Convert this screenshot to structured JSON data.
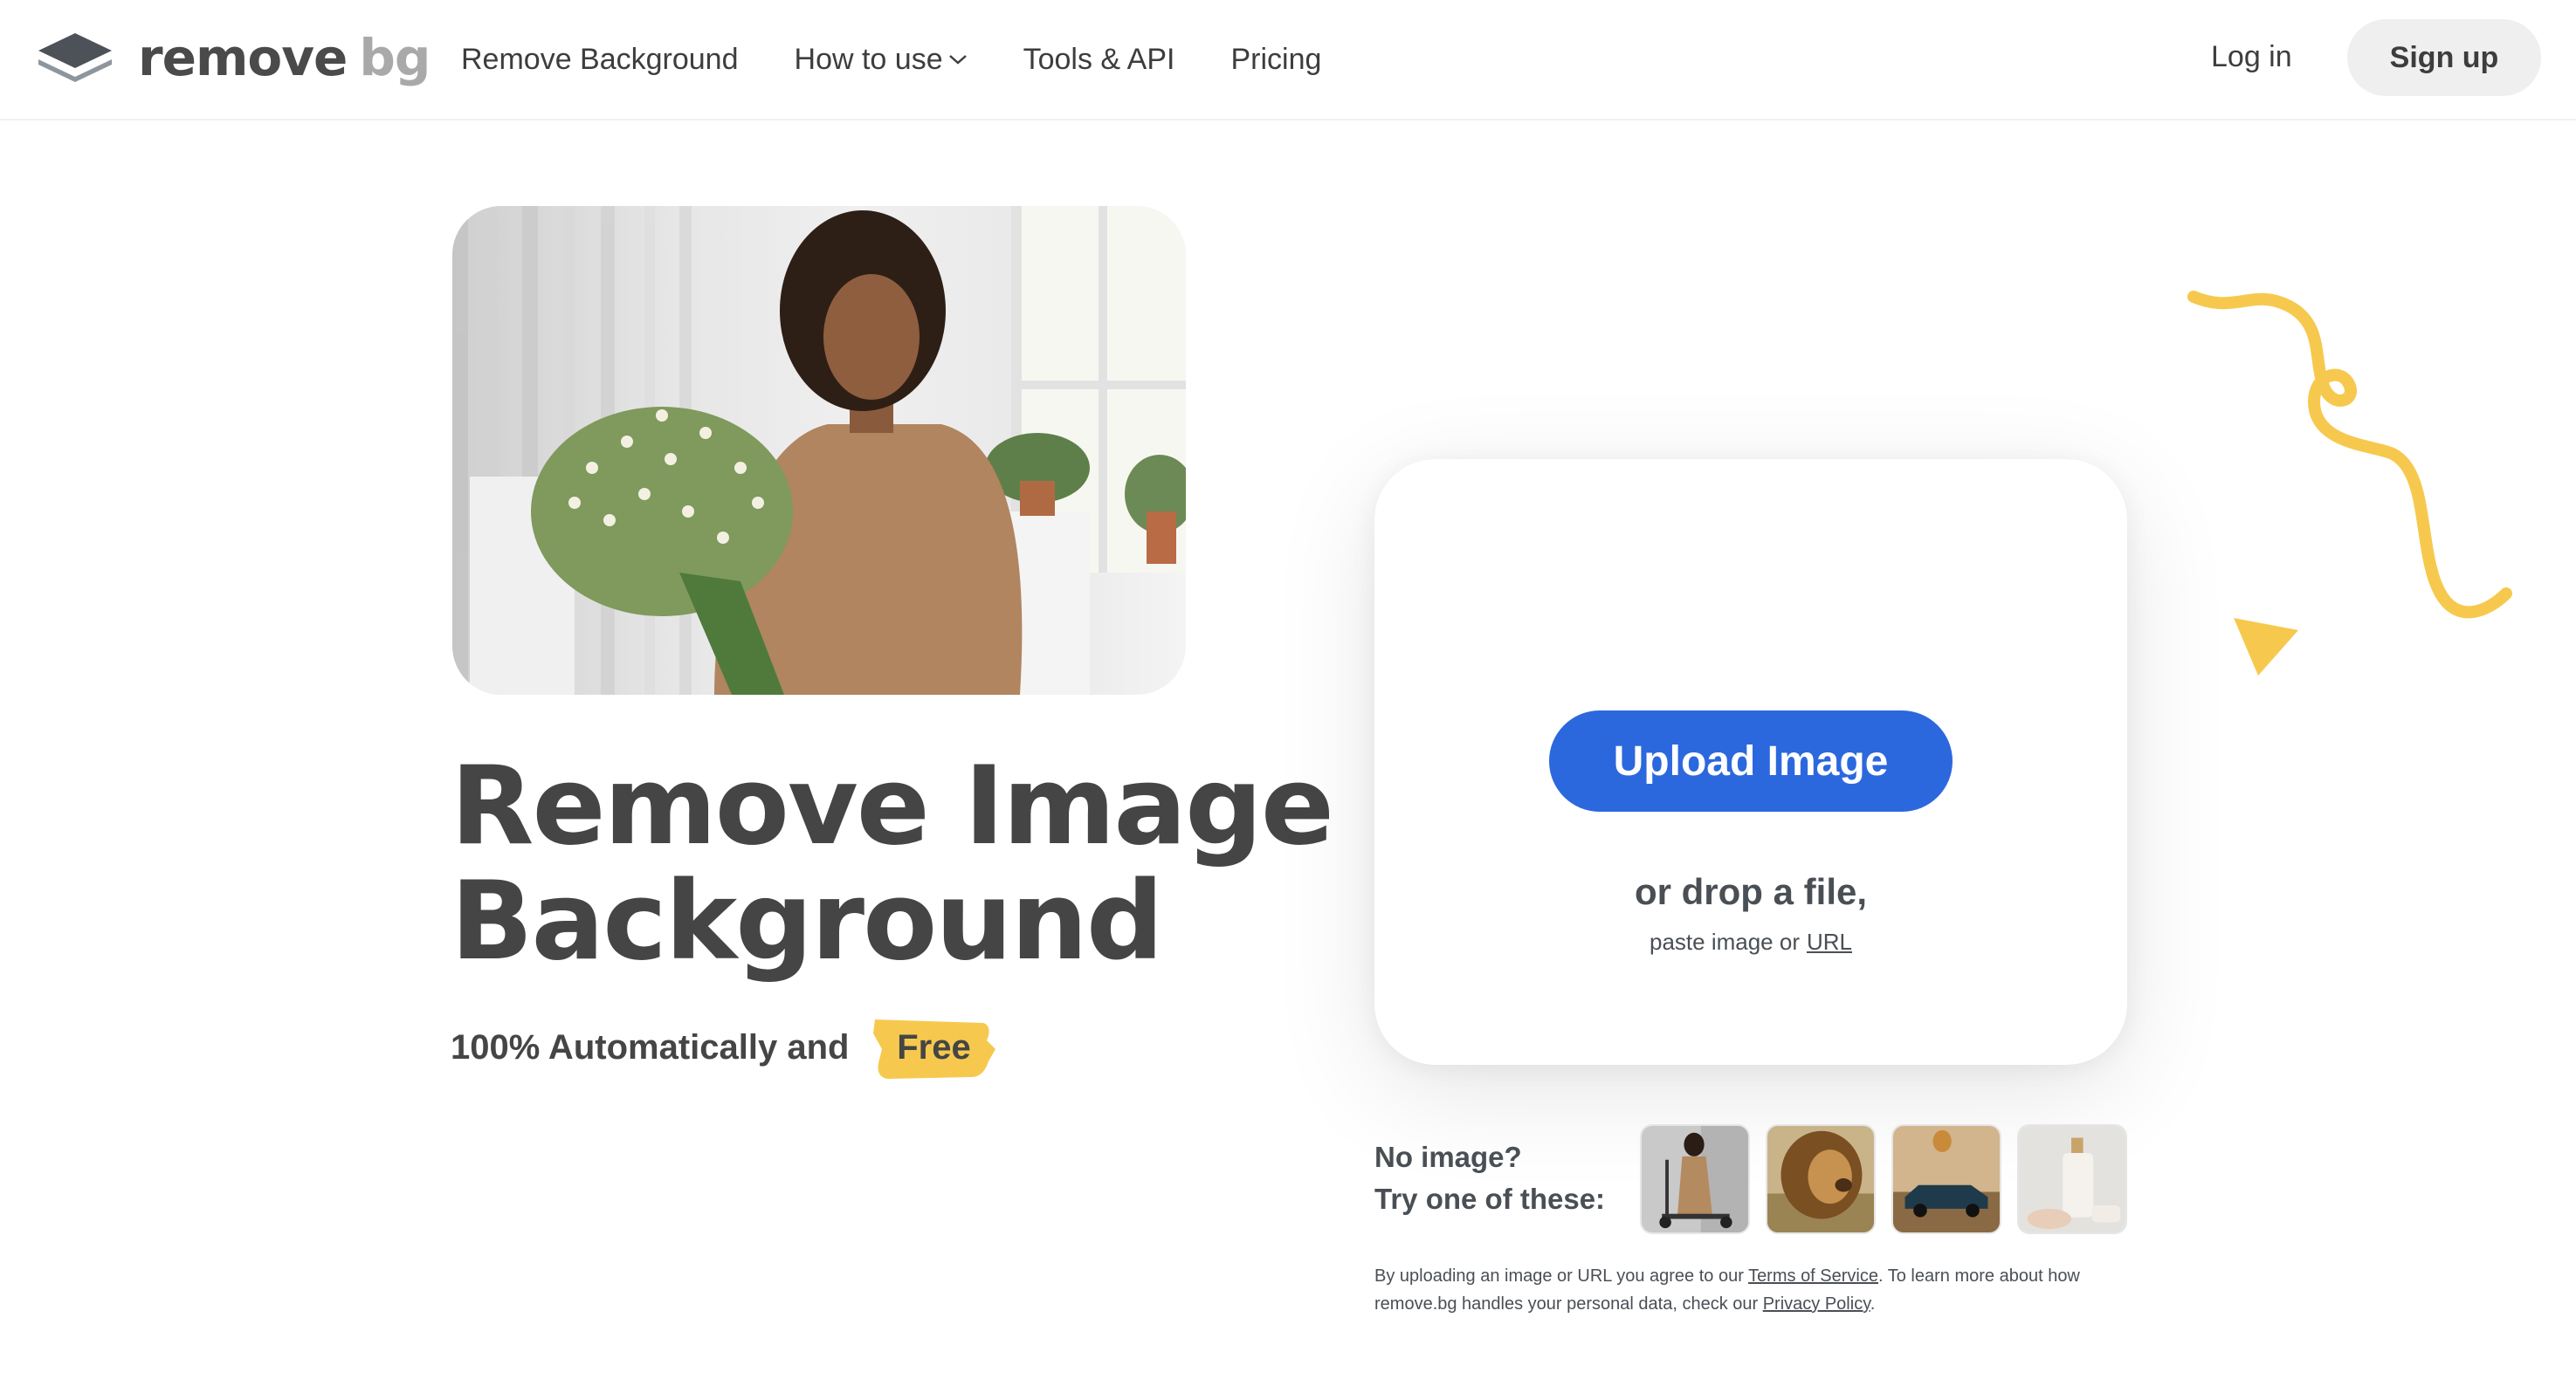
{
  "header": {
    "logo": {
      "word1": "remove",
      "word2": "bg",
      "icon": "layers-logo-icon"
    },
    "nav": [
      {
        "label": "Remove Background"
      },
      {
        "label": "How to use",
        "icon": "chevron-down-icon"
      },
      {
        "label": "Tools & API"
      },
      {
        "label": "Pricing"
      }
    ],
    "login_label": "Log in",
    "signup_label": "Sign up"
  },
  "hero": {
    "title_line1": "Remove Image",
    "title_line2": "Background",
    "subtitle": "100% Automatically and",
    "highlight": "Free"
  },
  "upload": {
    "button_label": "Upload Image",
    "drop_text": "or drop a file,",
    "paste_text": "paste image or",
    "url_link": "URL"
  },
  "samples": {
    "prompt_line1": "No image?",
    "prompt_line2": "Try one of these:",
    "thumbnails": [
      {
        "subject": "woman-with-scooter"
      },
      {
        "subject": "lion"
      },
      {
        "subject": "car-and-balloon"
      },
      {
        "subject": "cosmetic-bottle"
      }
    ]
  },
  "legal": {
    "text1": "By uploading an image or URL you agree to our",
    "terms_link": "Terms of Service",
    "text2": ". To learn more about how remove.bg handles your personal data, check our",
    "privacy_link": "Privacy Policy",
    "text3": "."
  },
  "colors": {
    "primary_blue": "#2c68dd",
    "accent_yellow": "#f6c94e",
    "text_dark": "#454545",
    "signup_bg": "#efefef"
  }
}
